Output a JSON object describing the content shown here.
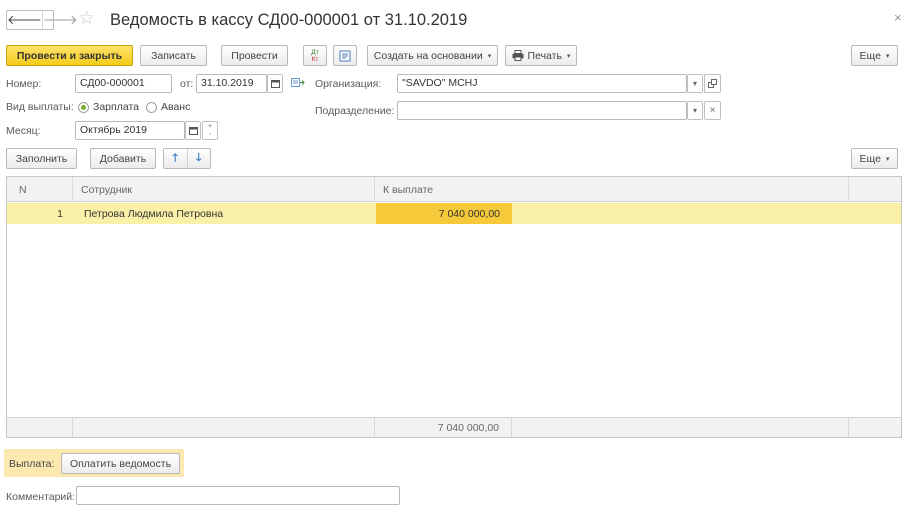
{
  "window": {
    "title": "Ведомость в кассу СД00-000001 от 31.10.2019",
    "back_glyph": "🡐",
    "forward_glyph": "🡒",
    "star_glyph": "☆",
    "close_glyph": "×"
  },
  "toolbar": {
    "post_and_close": "Провести и закрыть",
    "save": "Записать",
    "post": "Провести",
    "dt_kt_top": "Дт",
    "dt_kt_bottom": "Кт",
    "create_based_on": "Создать на основании",
    "print": "Печать",
    "more": "Еще",
    "caret_glyph": "▾"
  },
  "form": {
    "number_label": "Номер:",
    "number_value": "СД00-000001",
    "date_label": "от:",
    "date_value": "31.10.2019",
    "org_label": "Организация:",
    "org_value": "\"SAVDO\" MCHJ",
    "payment_type_label": "Вид выплаты:",
    "payment_type_options": [
      "Зарплата",
      "Аванс"
    ],
    "payment_type_selected": "Зарплата",
    "subdivision_label": "Подразделение:",
    "subdivision_value": "",
    "month_label": "Месяц:",
    "month_value": "Октябрь 2019"
  },
  "table_toolbar": {
    "fill": "Заполнить",
    "add": "Добавить",
    "move_up_glyph": "🡑",
    "move_down_glyph": "🡓",
    "more": "Еще"
  },
  "table": {
    "columns": [
      "N",
      "Сотрудник",
      "К выплате"
    ],
    "rows": [
      {
        "n": "1",
        "employee": "Петрова Людмила Петровна",
        "amount": "7 040 000,00"
      }
    ],
    "total": "7 040 000,00"
  },
  "payment": {
    "label": "Выплата:",
    "pay_button": "Оплатить ведомость"
  },
  "comment": {
    "label": "Комментарий:",
    "value": ""
  },
  "colors": {
    "accent_yellow": "#f5cc1c",
    "row_highlight": "#fbf0a8",
    "cell_selected": "#f5c93a",
    "radio_on": "#7aab2c"
  }
}
